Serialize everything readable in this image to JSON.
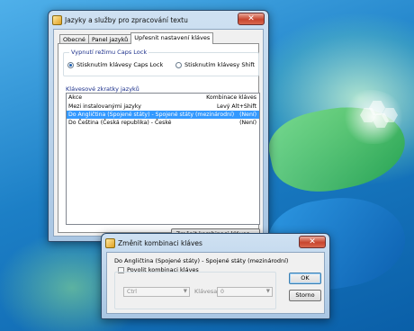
{
  "main_window": {
    "title": "Jazyky a služby pro zpracování textu",
    "close_symbol": "✕",
    "icon": "keyboard-icon",
    "tabs": [
      {
        "label": "Obecné",
        "active": false
      },
      {
        "label": "Panel jazyků",
        "active": false
      },
      {
        "label": "Upřesnit nastavení kláves",
        "active": true
      }
    ],
    "caps_lock": {
      "legend": "Vypnutí režimu Caps Lock",
      "options": [
        {
          "label": "Stisknutím klávesy Caps Lock",
          "checked": true
        },
        {
          "label": "Stisknutím klávesy Shift",
          "checked": false
        }
      ]
    },
    "hotkeys": {
      "legend": "Klávesové zkratky jazyků",
      "col_action": "Akce",
      "col_keys": "Kombinace kláves",
      "rows": [
        {
          "action": "Mezi instalovanými jazyky",
          "keys": "Levý Alt+Shift",
          "selected": false
        },
        {
          "action": "Do Angličtina (Spojené státy) - Spojené státy (mezinárodní)",
          "keys": "(Není)",
          "selected": true
        },
        {
          "action": "Do Čeština (Česká republika) - České",
          "keys": "(Není)",
          "selected": false
        }
      ],
      "change_button": "Změnit kombinaci kláves..."
    }
  },
  "dialog": {
    "title": "Změnit kombinaci kláves",
    "close_symbol": "✕",
    "icon": "keyboard-icon",
    "target": "Do Angličtina (Spojené státy) - Spojené státy (mezinárodní)",
    "enable_label": "Povolit kombinaci kláves",
    "enable_checked": false,
    "modifier_value": "Ctrl",
    "key_label": "Klávesa:",
    "key_value": "0",
    "ok_label": "OK",
    "cancel_label": "Storno"
  }
}
